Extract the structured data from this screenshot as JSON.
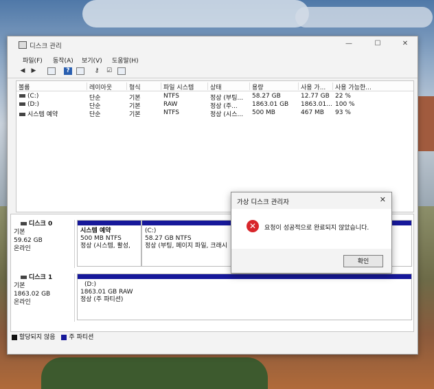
{
  "window": {
    "title": "디스크 관리",
    "minimize": "—",
    "maximize": "☐",
    "close": "✕"
  },
  "menu": [
    "파일(F)",
    "동작(A)",
    "보기(V)",
    "도움말(H)"
  ],
  "toolbar_icons": [
    "back-arrow-icon",
    "forward-arrow-icon",
    "properties-icon",
    "help-icon",
    "view-icon",
    "check-icon",
    "key-icon",
    "list-icon"
  ],
  "volume_columns": [
    "볼륨",
    "레이아웃",
    "형식",
    "파일 시스템",
    "상태",
    "용량",
    "사용 가...",
    "사용 가능한..."
  ],
  "volumes": [
    {
      "name": "(C:)",
      "layout": "단순",
      "type": "기본",
      "fs": "NTFS",
      "status": "정상 (부팅...",
      "capacity": "58.27 GB",
      "free": "12.77 GB",
      "pct": "22 %"
    },
    {
      "name": "(D:)",
      "layout": "단순",
      "type": "기본",
      "fs": "RAW",
      "status": "정상 (주...",
      "capacity": "1863.01 GB",
      "free": "1863.01...",
      "pct": "100 %"
    },
    {
      "name": "시스템 예약",
      "layout": "단순",
      "type": "기본",
      "fs": "NTFS",
      "status": "정상 (시스...",
      "capacity": "500 MB",
      "free": "467 MB",
      "pct": "93 %"
    }
  ],
  "disks": [
    {
      "name": "디스크 0",
      "kind": "기본",
      "size": "59.62 GB",
      "state": "온라인",
      "partitions": [
        {
          "label": "시스템 예약",
          "size": "500 MB NTFS",
          "status": "정상 (시스템, 활성,"
        },
        {
          "label": "(C:)",
          "size": "58.27 GB NTFS",
          "status": "정상 (부팅, 페이지 파일, 크래시"
        }
      ]
    },
    {
      "name": "디스크 1",
      "kind": "기본",
      "size": "1863.02 GB",
      "state": "온라인",
      "partitions": [
        {
          "label": "(D:)",
          "size": "1863.01 GB RAW",
          "status": "정상 (주 파티션)"
        }
      ]
    }
  ],
  "legend": {
    "unallocated": "할당되지 않음",
    "primary": "주 파티션"
  },
  "colors": {
    "primary_partition": "#16189a",
    "unallocated": "#111111",
    "error": "#d8262b"
  },
  "dialog": {
    "title": "가상 디스크 관리자",
    "message": "요청이 성공적으로 완료되지 않았습니다.",
    "ok": "확인",
    "close": "✕",
    "icon": "error-icon"
  }
}
